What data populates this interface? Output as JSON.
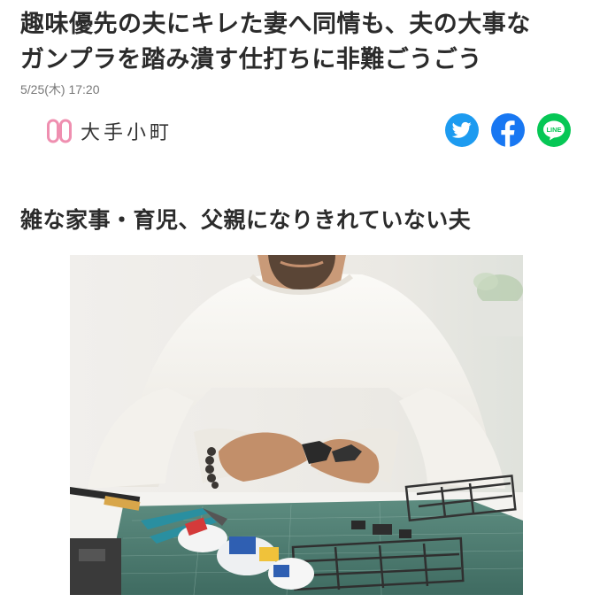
{
  "article": {
    "headline_line1": "趣味優先の夫にキレた妻へ同情も、夫の大事な",
    "headline_line2": "ガンプラを踏み潰す仕打ちに非難ごうごう",
    "date": "5/25(木) 17:20",
    "source_name": "大手小町",
    "section_heading": "雑な家事・育児、父親になりきれていない夫"
  },
  "share": {
    "twitter_color": "#1d9bf0",
    "facebook_color": "#1877f2",
    "line_color": "#06c755",
    "line_label": "LINE"
  },
  "logo": {
    "accent_color": "#ef8fb0"
  }
}
